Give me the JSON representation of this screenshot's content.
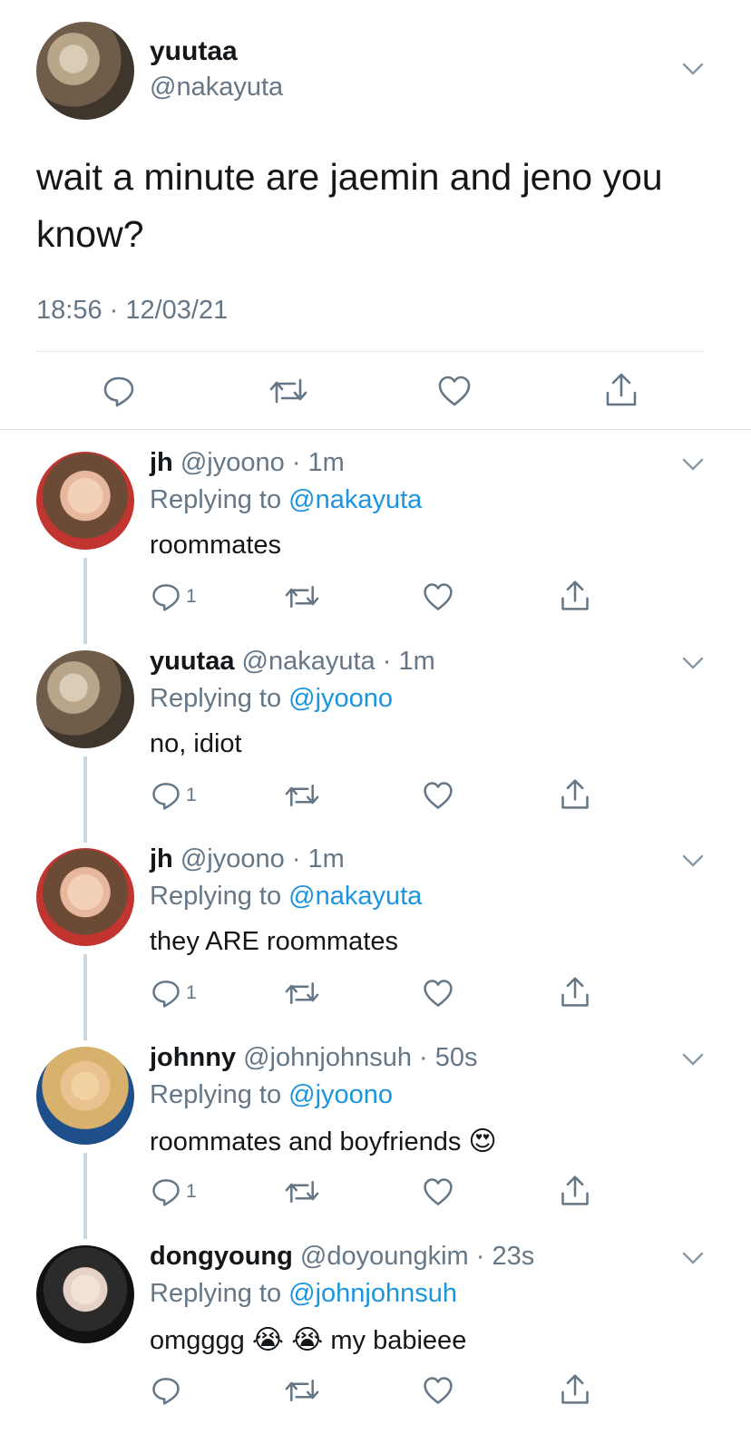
{
  "main_tweet": {
    "display_name": "yuutaa",
    "handle": "@nakayuta",
    "text": "wait a minute are jaemin and jeno you know?",
    "timestamp": "18:56 · 12/03/21"
  },
  "replies": [
    {
      "display_name": "jh",
      "handle": "@jyoono",
      "time": "· 1m",
      "replying_label": "Replying to",
      "replying_to": "@nakayuta",
      "text": "roommates",
      "reply_count": "1"
    },
    {
      "display_name": "yuutaa",
      "handle": "@nakayuta",
      "time": "· 1m",
      "replying_label": "Replying to",
      "replying_to": "@jyoono",
      "text": "no, idiot",
      "reply_count": "1"
    },
    {
      "display_name": "jh",
      "handle": "@jyoono",
      "time": "· 1m",
      "replying_label": "Replying to",
      "replying_to": "@nakayuta",
      "text": "they ARE roommates",
      "reply_count": "1"
    },
    {
      "display_name": "johnny",
      "handle": "@johnjohnsuh",
      "time": "· 50s",
      "replying_label": "Replying to",
      "replying_to": "@jyoono",
      "text": "roommates and boyfriends",
      "emoji": "😍",
      "reply_count": "1"
    },
    {
      "display_name": "dongyoung",
      "handle": "@doyoungkim",
      "time": "· 23s",
      "replying_label": "Replying to",
      "replying_to": "@johnjohnsuh",
      "text_a": "omgggg",
      "emoji": "😭 😭",
      "text_b": "my babieee",
      "reply_count": ""
    }
  ],
  "colors": {
    "link": "#1b95e0",
    "muted": "#657786",
    "divider": "#e1e8ed",
    "thread_line": "#ccd6dd"
  },
  "icons": [
    "chevron-down-icon",
    "reply-icon",
    "retweet-icon",
    "like-icon",
    "share-icon"
  ]
}
